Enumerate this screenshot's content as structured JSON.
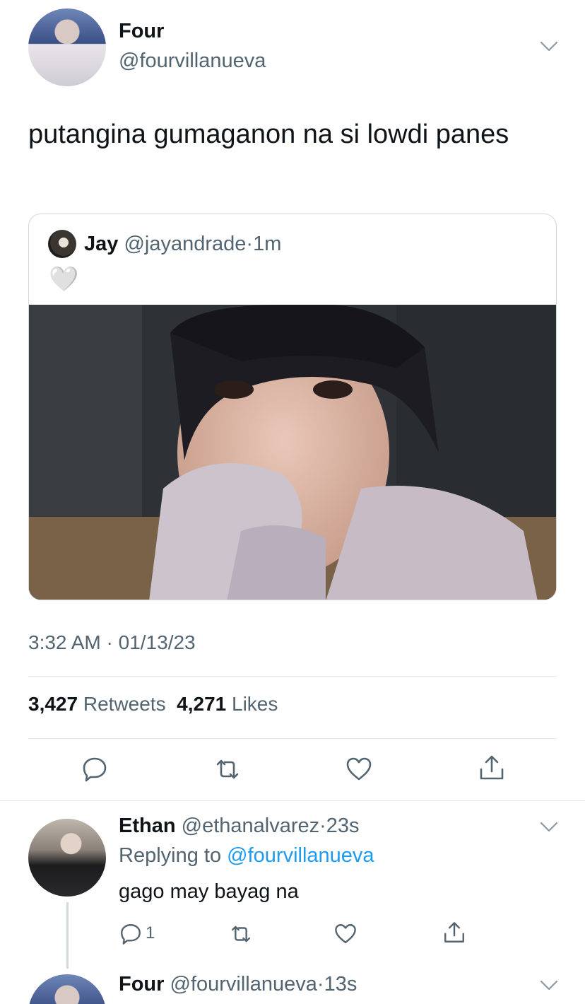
{
  "tweet": {
    "author_name": "Four",
    "author_handle": "@fourvillanueva",
    "text": "putangina gumaganon na si lowdi panes",
    "time": "3:32 AM",
    "date_sep": "·",
    "date": "01/13/23",
    "retweets_count": "3,427",
    "retweets_label": "Retweets",
    "likes_count": "4,271",
    "likes_label": "Likes"
  },
  "quote": {
    "author_name": "Jay",
    "author_handle": "@jayandrade",
    "sep": "·",
    "age": "1m",
    "text": "🤍"
  },
  "reply": {
    "author_name": "Ethan",
    "author_handle": "@ethanalvarez",
    "sep": "·",
    "age": "23s",
    "replying_prefix": "Replying to",
    "replying_to": "@fourvillanueva",
    "text": "gago may bayag na",
    "reply_count": "1"
  },
  "reply2": {
    "author_name": "Four",
    "author_handle": "@fourvillanueva",
    "sep": "·",
    "age": "13s"
  },
  "colors": {
    "text": "#0f1419",
    "secondary": "#536471",
    "link": "#1d9bf0",
    "border": "#cfd9de"
  },
  "icons": [
    "chevron-down-icon",
    "comment-icon",
    "retweet-icon",
    "like-icon",
    "share-icon",
    "white-heart-emoji"
  ]
}
